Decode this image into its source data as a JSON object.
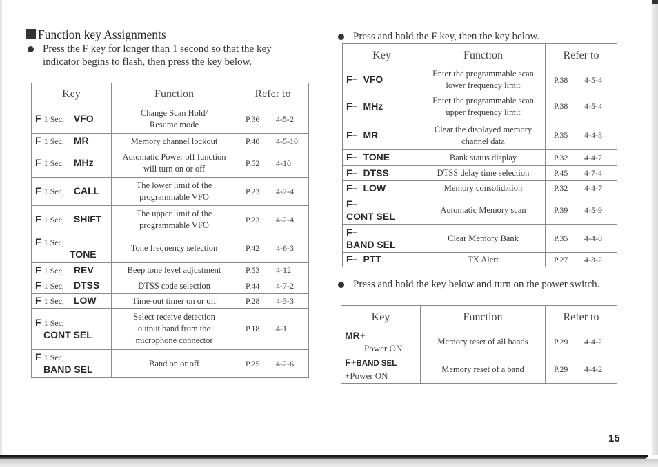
{
  "page": {
    "title": "Function key Assignments",
    "number": "15"
  },
  "left": {
    "intro": "Press the F key for longer than 1 second so that the key indicator begins to flash, then press the key below.",
    "headers": {
      "key": "Key",
      "function": "Function",
      "refer": "Refer to"
    },
    "rows": [
      {
        "f": "F",
        "sec": "1 Sec,",
        "key": "VFO",
        "function": [
          "Change Scan Hold/",
          "Resume mode"
        ],
        "page": "P.36",
        "section": "4-5-2"
      },
      {
        "f": "F",
        "sec": "1 Sec,",
        "key": "MR",
        "function": [
          "Memory channel lockout"
        ],
        "page": "P.40",
        "section": "4-5-10"
      },
      {
        "f": "F",
        "sec": "1 Sec,",
        "key": "MHz",
        "function": [
          "Automatic Power off function",
          "will turn on or off"
        ],
        "page": "P.52",
        "section": "4-10"
      },
      {
        "f": "F",
        "sec": "1 Sec,",
        "key": "CALL",
        "function": [
          "The lower limit of the",
          "programmable VFO"
        ],
        "page": "P.23",
        "section": "4-2-4"
      },
      {
        "f": "F",
        "sec": "1 Sec,",
        "key": "SHIFT",
        "function": [
          "The upper limit of the",
          "programmable VFO"
        ],
        "page": "P.23",
        "section": "4-2-4"
      },
      {
        "f": "F",
        "sec": "1 Sec,",
        "key": "TONE",
        "function": [
          "Tone frequency selection"
        ],
        "page": "P.42",
        "section": "4-6-3"
      },
      {
        "f": "F",
        "sec": "1 Sec,",
        "key": "REV",
        "function": [
          "Beep tone level adjustment"
        ],
        "page": "P.53",
        "section": "4-12"
      },
      {
        "f": "F",
        "sec": "1 Sec,",
        "key": "DTSS",
        "function": [
          "DTSS code  selection"
        ],
        "page": "P.44",
        "section": "4-7-2"
      },
      {
        "f": "F",
        "sec": "1 Sec,",
        "key": "LOW",
        "function": [
          "Time-out timer on or off"
        ],
        "page": "P.28",
        "section": "4-3-3"
      },
      {
        "f": "F",
        "sec": "1 Sec,",
        "key": "CONT SEL",
        "function": [
          "Select receive detection",
          "output band from the",
          "microphone connector"
        ],
        "page": "P.18",
        "section": "4-1"
      },
      {
        "f": "F",
        "sec": "1 Sec,",
        "key": "BAND SEL",
        "function": [
          "Band on or off"
        ],
        "page": "P.25",
        "section": "4-2-6"
      }
    ]
  },
  "right_top": {
    "intro": "Press and hold the F key, then the key below.",
    "headers": {
      "key": "Key",
      "function": "Function",
      "refer": "Refer to"
    },
    "rows": [
      {
        "f": "F",
        "plus": "+",
        "key": "VFO",
        "function": [
          "Enter the programmable scan",
          "lower frequency limit"
        ],
        "page": "P.38",
        "section": "4-5-4"
      },
      {
        "f": "F",
        "plus": "+",
        "key": "MHz",
        "function": [
          "Enter the programmable scan",
          "upper frequency limit"
        ],
        "page": "P.38",
        "section": "4-5-4"
      },
      {
        "f": "F",
        "plus": "+",
        "key": "MR",
        "function": [
          "Clear the displayed memory",
          "channel data"
        ],
        "page": "P.35",
        "section": "4-4-8"
      },
      {
        "f": "F",
        "plus": "+",
        "key": "TONE",
        "function": [
          "Bank status display"
        ],
        "page": "P.32",
        "section": "4-4-7"
      },
      {
        "f": "F",
        "plus": "+",
        "key": "DTSS",
        "function": [
          "DTSS delay time selection"
        ],
        "page": "P.45",
        "section": "4-7-4"
      },
      {
        "f": "F",
        "plus": "+",
        "key": "LOW",
        "function": [
          "Memory consolidation"
        ],
        "page": "P.32",
        "section": "4-4-7"
      },
      {
        "f": "F",
        "plus": "+",
        "key": "CONT SEL",
        "function": [
          "Automatic Memory scan"
        ],
        "page": "P.39",
        "section": "4-5-9"
      },
      {
        "f": "F",
        "plus": "+",
        "key": "BAND SEL",
        "function": [
          "Clear Memory Bank"
        ],
        "page": "P.35",
        "section": "4-4-8"
      },
      {
        "f": "F",
        "plus": "+",
        "key": "PTT",
        "function": [
          "TX Alert"
        ],
        "page": "P.27",
        "section": "4-3-2"
      }
    ]
  },
  "right_bottom": {
    "intro": "Press and hold the key below and turn on the power switch.",
    "headers": {
      "key": "Key",
      "function": "Function",
      "refer": "Refer to"
    },
    "rows": [
      {
        "key": "MR",
        "plus": "+",
        "second": "Power ON",
        "function": [
          "Memory reset of all bands"
        ],
        "page": "P.29",
        "section": "4-4-2"
      },
      {
        "f": "F",
        "plus": "+",
        "key": "BAND SEL",
        "second": "+Power ON",
        "function": [
          "Memory reset of a band"
        ],
        "page": "P.29",
        "section": "4-4-2"
      }
    ]
  }
}
